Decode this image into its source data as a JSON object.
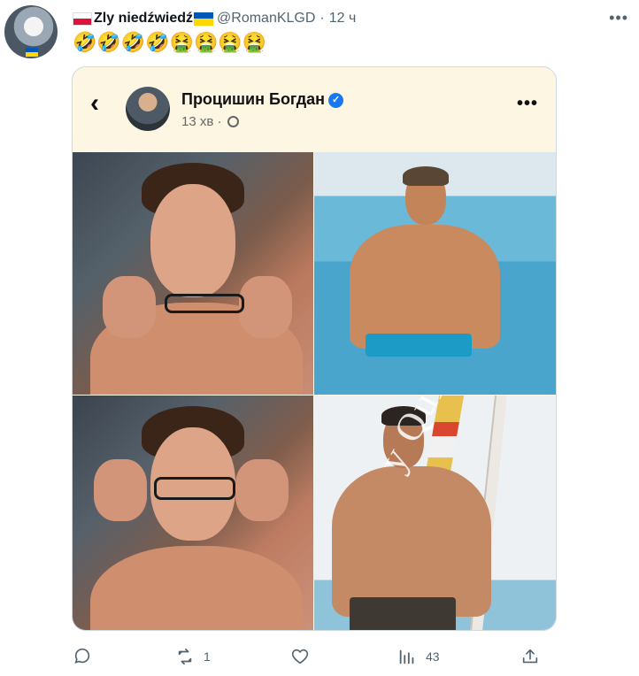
{
  "tweet": {
    "author_name": "Zly niedźwiedź",
    "handle": "@RomanKLGD",
    "separator": "·",
    "time": "12 ч",
    "text": "🤣🤣🤣🤣🤮🤮🤮🤮",
    "more_label": "•••"
  },
  "embedded_post": {
    "name": "Процишин Богдан",
    "verified_mark": "✓",
    "time": "13 хв",
    "separator": "·",
    "back_glyph": "‹",
    "more_label": "•••",
    "watermark": "y Quinn",
    "meme_panels": [
      {
        "description_icon": "man-looking-over-glasses"
      },
      {
        "description_icon": "muscular-man-in-sea"
      },
      {
        "description_icon": "man-putting-on-glasses"
      },
      {
        "description_icon": "shirtless-man-on-beach"
      }
    ]
  },
  "actions": {
    "reply_count": "",
    "retweet_count": "1",
    "like_count": "",
    "views_count": "43",
    "share_count": ""
  },
  "colors": {
    "secondary_text": "#536471",
    "verified_blue": "#1877f2",
    "facebook_header_bg": "#fcf6e3",
    "border": "#cfd9de"
  }
}
